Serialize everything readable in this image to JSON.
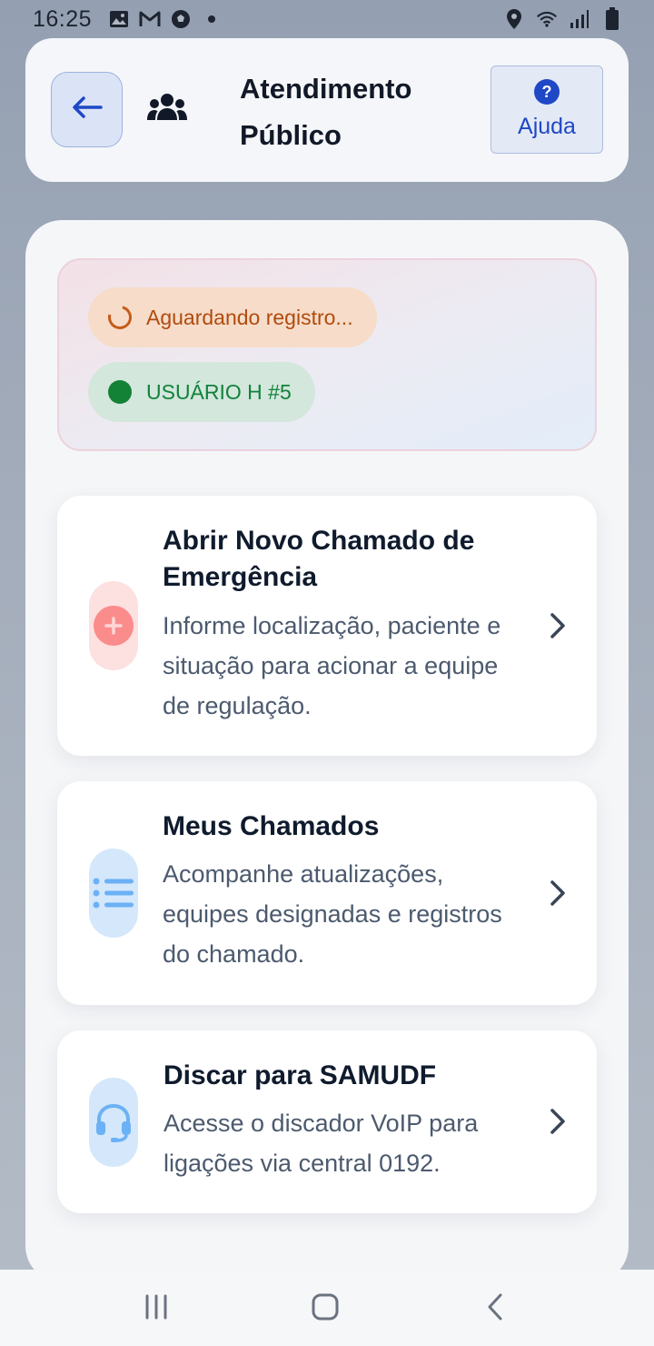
{
  "status_bar": {
    "time": "16:25",
    "left_icons": [
      "image-icon",
      "gmail-icon",
      "soccer-ball-icon",
      "dot-icon"
    ],
    "right_icons": [
      "location-icon",
      "wifi-icon",
      "signal-icon",
      "battery-icon"
    ]
  },
  "header": {
    "back_icon": "arrow-left-icon",
    "users_icon": "users-icon",
    "title": "Atendimento Público",
    "help_label": "Ajuda",
    "help_icon": "question-circle-icon"
  },
  "status_box": {
    "waiting_text": "Aguardando registro...",
    "user_text": "USUÁRIO H #5",
    "colors": {
      "waiting": "#b14b0e",
      "user": "#12823a"
    }
  },
  "actions": [
    {
      "title": "Abrir Novo Chamado de Emergência",
      "description": "Informe localização, paciente e situação para acionar a equipe de regulação.",
      "icon": "plus-circle-icon",
      "accent": "#f87171"
    },
    {
      "title": "Meus Chamados",
      "description": "Acompanhe atualizações, equipes designadas e registros do chamado.",
      "icon": "list-icon",
      "accent": "#60a5fa"
    },
    {
      "title": "Discar para SAMUDF",
      "description": "Acesse o discador VoIP para ligações via central 0192.",
      "icon": "headset-icon",
      "accent": "#60a5fa"
    }
  ],
  "nav_bar": {
    "buttons": [
      "recent-apps-icon",
      "home-icon",
      "back-icon"
    ]
  }
}
